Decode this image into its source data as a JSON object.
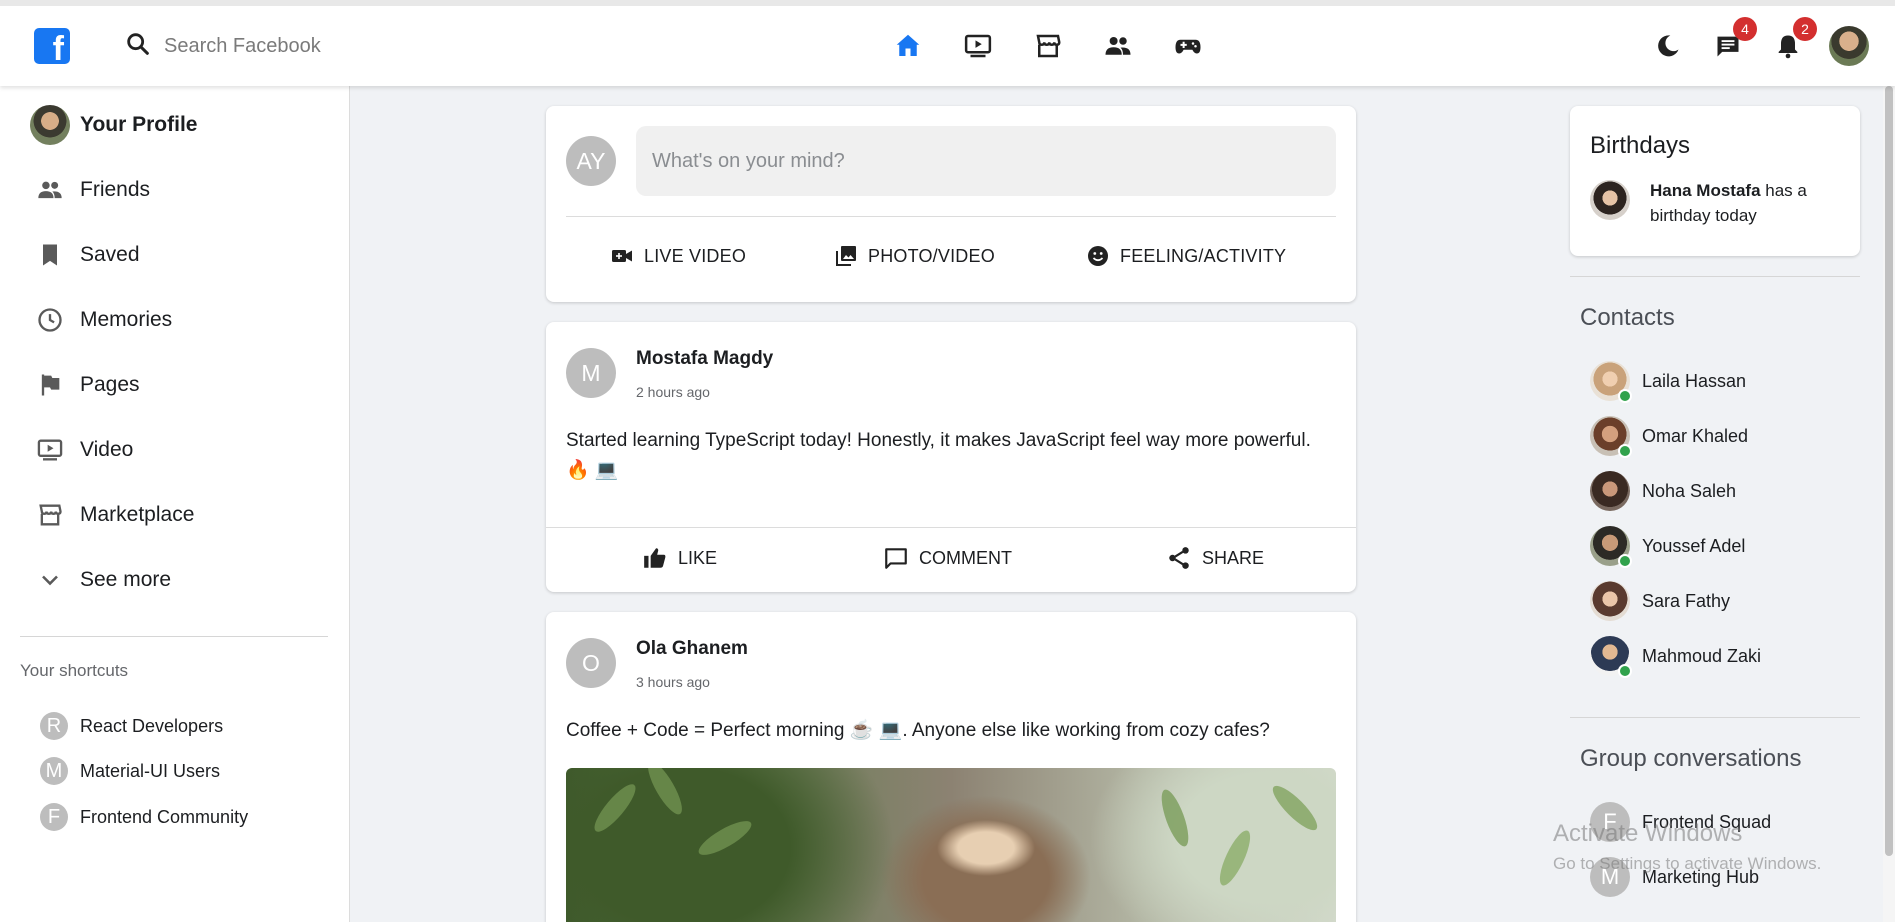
{
  "header": {
    "search_placeholder": "Search Facebook",
    "messages_badge": "4",
    "notifications_badge": "2"
  },
  "sidebar": {
    "profile_label": "Your Profile",
    "items": [
      {
        "label": "Friends",
        "icon": "friends-icon"
      },
      {
        "label": "Saved",
        "icon": "bookmark-icon"
      },
      {
        "label": "Memories",
        "icon": "clock-icon"
      },
      {
        "label": "Pages",
        "icon": "flag-icon"
      },
      {
        "label": "Video",
        "icon": "video-icon"
      },
      {
        "label": "Marketplace",
        "icon": "store-icon"
      },
      {
        "label": "See more",
        "icon": "chevron-down-icon"
      }
    ],
    "shortcuts_title": "Your shortcuts",
    "shortcuts": [
      {
        "letter": "R",
        "label": "React Developers"
      },
      {
        "letter": "M",
        "label": "Material-UI Users"
      },
      {
        "letter": "F",
        "label": "Frontend Community"
      }
    ]
  },
  "composer": {
    "avatar_initials": "AY",
    "placeholder": "What's on your mind?",
    "live_label": "LIVE VIDEO",
    "photo_label": "PHOTO/VIDEO",
    "feeling_label": "FEELING/ACTIVITY"
  },
  "posts": [
    {
      "initial": "M",
      "author": "Mostafa Magdy",
      "time": "2 hours ago",
      "text": "Started learning TypeScript today! Honestly, it makes JavaScript feel way more powerful. 🔥 💻"
    },
    {
      "initial": "O",
      "author": "Ola Ghanem",
      "time": "3 hours ago",
      "text": "Coffee + Code = Perfect morning ☕ 💻. Anyone else like working from cozy cafes?"
    }
  ],
  "post_actions": {
    "like": "LIKE",
    "comment": "COMMENT",
    "share": "SHARE"
  },
  "birthdays": {
    "title": "Birthdays",
    "name": "Hana Mostafa",
    "suffix": " has a birthday today"
  },
  "contacts": {
    "title": "Contacts",
    "items": [
      {
        "name": "Laila Hassan",
        "online": true
      },
      {
        "name": "Omar Khaled",
        "online": true
      },
      {
        "name": "Noha Saleh",
        "online": false
      },
      {
        "name": "Youssef Adel",
        "online": true
      },
      {
        "name": "Sara Fathy",
        "online": false
      },
      {
        "name": "Mahmoud Zaki",
        "online": true
      }
    ]
  },
  "groups": {
    "title": "Group conversations",
    "items": [
      {
        "letter": "F",
        "name": "Frontend Squad"
      },
      {
        "letter": "M",
        "name": "Marketing Hub"
      }
    ]
  },
  "watermark": {
    "line1": "Activate Windows",
    "line2": "Go to Settings to activate Windows."
  },
  "colors": {
    "brand": "#1877f2",
    "badge": "#d32f2f",
    "online": "#31a24c"
  }
}
